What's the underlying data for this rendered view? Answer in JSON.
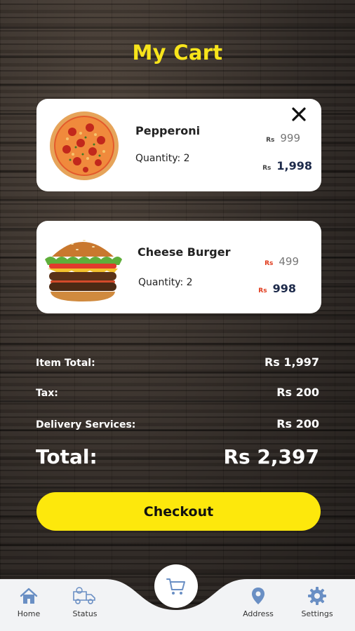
{
  "header": {
    "title": "My Cart"
  },
  "cart": {
    "items": [
      {
        "name": "Pepperoni",
        "quantity_text": "Quantity: 2",
        "currency": "Rs",
        "unit_price": "999",
        "line_total": "1,998",
        "image": "pizza-image"
      },
      {
        "name": "Cheese Burger",
        "quantity_text": "Quantity: 2",
        "currency": "Rs",
        "unit_price": "499",
        "line_total": "998",
        "image": "burger-image"
      }
    ]
  },
  "summary": {
    "item_total_label": "Item Total:",
    "item_total_value": "Rs 1,997",
    "tax_label": "Tax:",
    "tax_value": "Rs 200",
    "delivery_label": "Delivery Services:",
    "delivery_value": "Rs 200",
    "total_label": "Total:",
    "total_value": "Rs 2,397"
  },
  "checkout_label": "Checkout",
  "nav": {
    "home": "Home",
    "status": "Status",
    "address": "Address",
    "settings": "Settings"
  },
  "colors": {
    "accent": "#fde80c",
    "title": "#f7e41b",
    "nav_icon": "#6a8fc4",
    "burger_currency": "#e0391a"
  }
}
